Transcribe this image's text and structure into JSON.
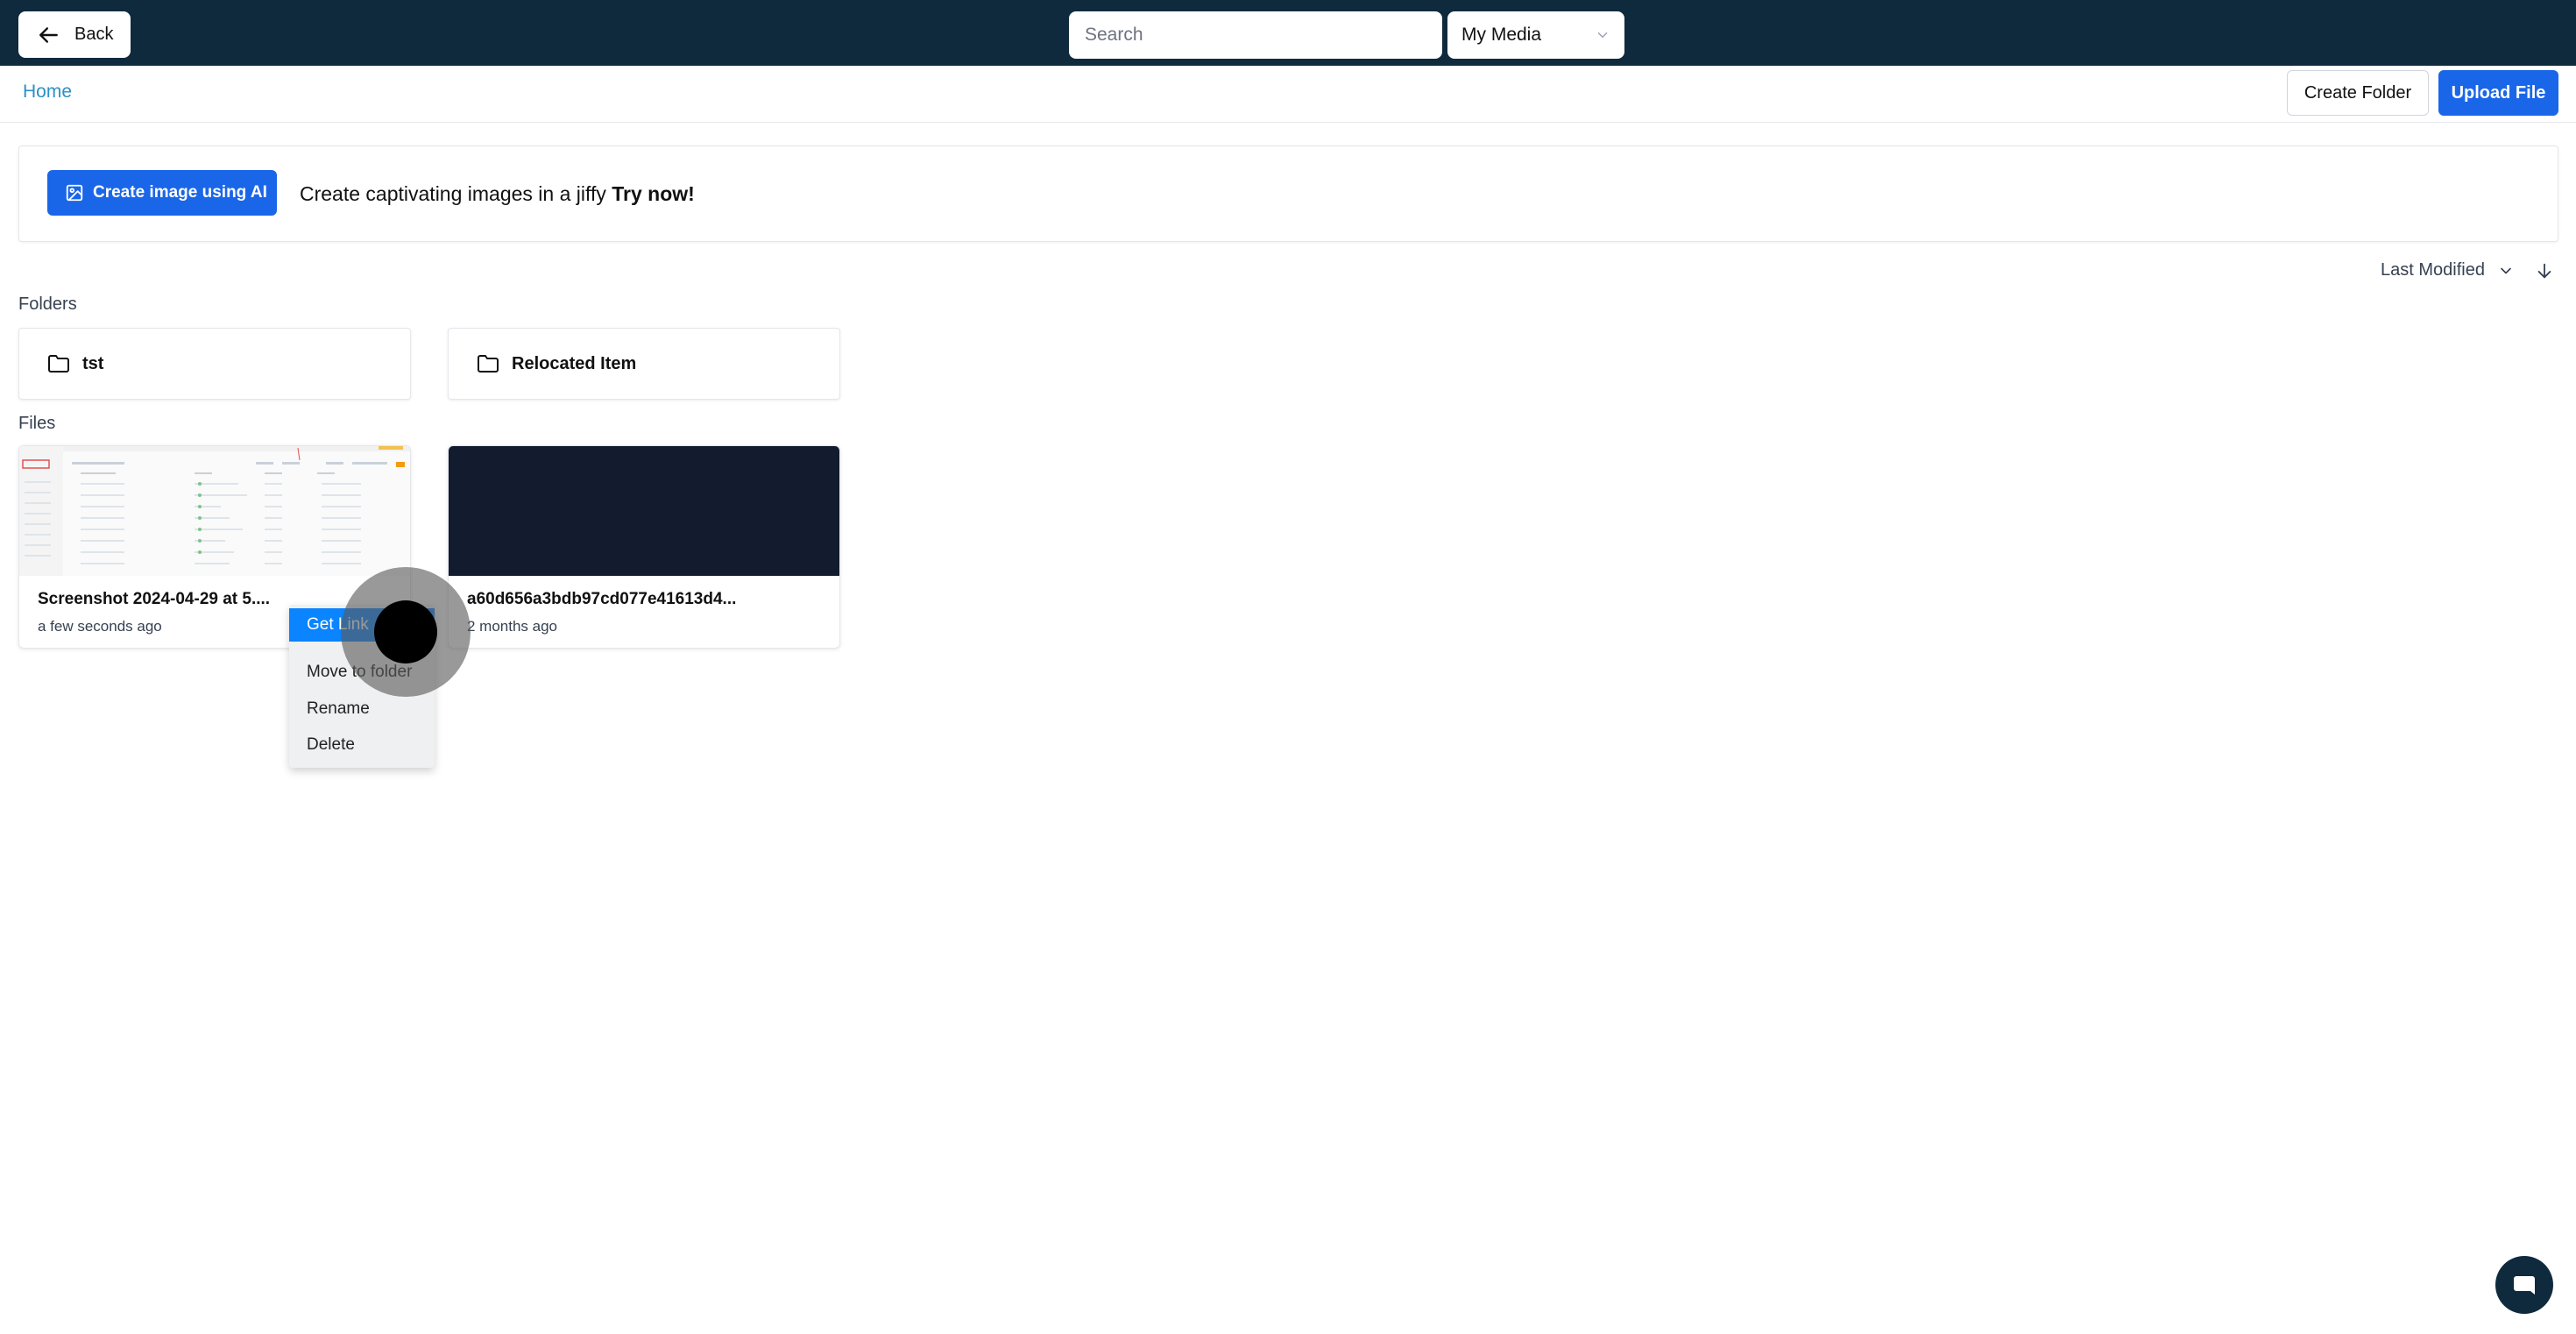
{
  "topbar": {
    "back_label": "Back",
    "search_placeholder": "Search",
    "media_select_value": "My Media"
  },
  "breadcrumb": {
    "home": "Home"
  },
  "actions": {
    "create_folder": "Create Folder",
    "upload_file": "Upload File"
  },
  "ai_banner": {
    "button_label": "Create image using AI",
    "text": "Create captivating images in a jiffy",
    "cta": "Try now!"
  },
  "sort": {
    "label": "Last Modified"
  },
  "folders": {
    "heading": "Folders",
    "items": [
      {
        "name": "tst"
      },
      {
        "name": "Relocated Item"
      }
    ]
  },
  "files": {
    "heading": "Files",
    "items": [
      {
        "name": "Screenshot 2024-04-29 at 5....",
        "time": "a few seconds ago"
      },
      {
        "name": "a60d656a3bdb97cd077e41613d4...",
        "time": "2 months ago"
      }
    ]
  },
  "context_menu": {
    "items": [
      {
        "label": "Get Link"
      },
      {
        "label": "Move to folder"
      },
      {
        "label": "Rename"
      },
      {
        "label": "Delete"
      }
    ]
  },
  "colors": {
    "topbar": "#0f2a3d",
    "primary": "#1a66e8",
    "link": "#2b8fc7",
    "menu_highlight": "#0a84ff"
  }
}
